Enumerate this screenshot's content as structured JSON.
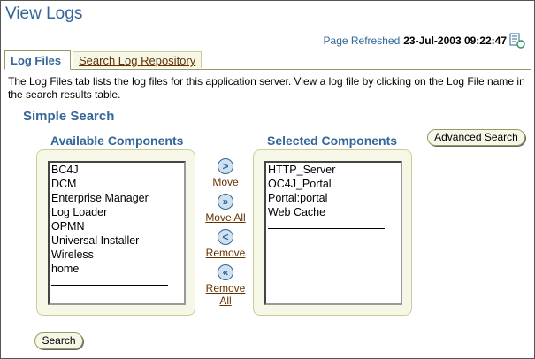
{
  "header": {
    "title": "View Logs",
    "refresh_label": "Page Refreshed",
    "refresh_timestamp": "23-Jul-2003 09:22:47"
  },
  "tabs": [
    {
      "label": "Log Files",
      "active": true
    },
    {
      "label": "Search Log Repository",
      "active": false
    }
  ],
  "description": "The Log Files tab lists the log files for this application server. View a log file by clicking on the Log File name in the search results table.",
  "simple_search": {
    "title": "Simple Search",
    "advanced_button": "Advanced Search",
    "available": {
      "heading": "Available Components",
      "items": [
        "BC4J",
        "DCM",
        "Enterprise Manager",
        "Log Loader",
        "OPMN",
        "Universal Installer",
        "Wireless",
        "home"
      ]
    },
    "selected": {
      "heading": "Selected Components",
      "items": [
        "HTTP_Server",
        "OC4J_Portal",
        "Portal:portal",
        "Web Cache"
      ]
    },
    "shuttle": {
      "move": "Move",
      "move_all": "Move All",
      "remove": "Remove",
      "remove_all_line1": "Remove",
      "remove_all_line2": "All"
    },
    "search_button": "Search"
  },
  "icons": {
    "refresh": "refresh-page-icon",
    "move": "arrow-right-icon",
    "move_all": "double-arrow-right-icon",
    "remove": "arrow-left-icon",
    "remove_all": "double-arrow-left-icon"
  },
  "colors": {
    "heading_blue": "#336699",
    "link_brown": "#663300",
    "panel_beige": "#f7f7e7",
    "rule_tan": "#cccc99"
  }
}
